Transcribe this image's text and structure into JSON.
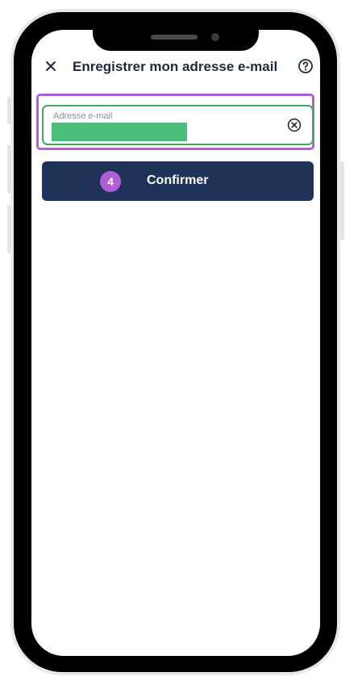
{
  "header": {
    "close_icon": "close-icon",
    "title": "Enregistrer mon adresse e-mail",
    "help_icon": "help-circle-icon"
  },
  "email_field": {
    "label": "Adresse e-mail",
    "value": "",
    "clear_icon": "clear-circle-icon"
  },
  "step_badge": "4",
  "confirm_button": {
    "label": "Confirmer"
  },
  "colors": {
    "accent_green": "#40a66e",
    "highlight_purple": "#b45fd8",
    "button_navy": "#1f3358",
    "title_text": "#1d2b3f"
  }
}
